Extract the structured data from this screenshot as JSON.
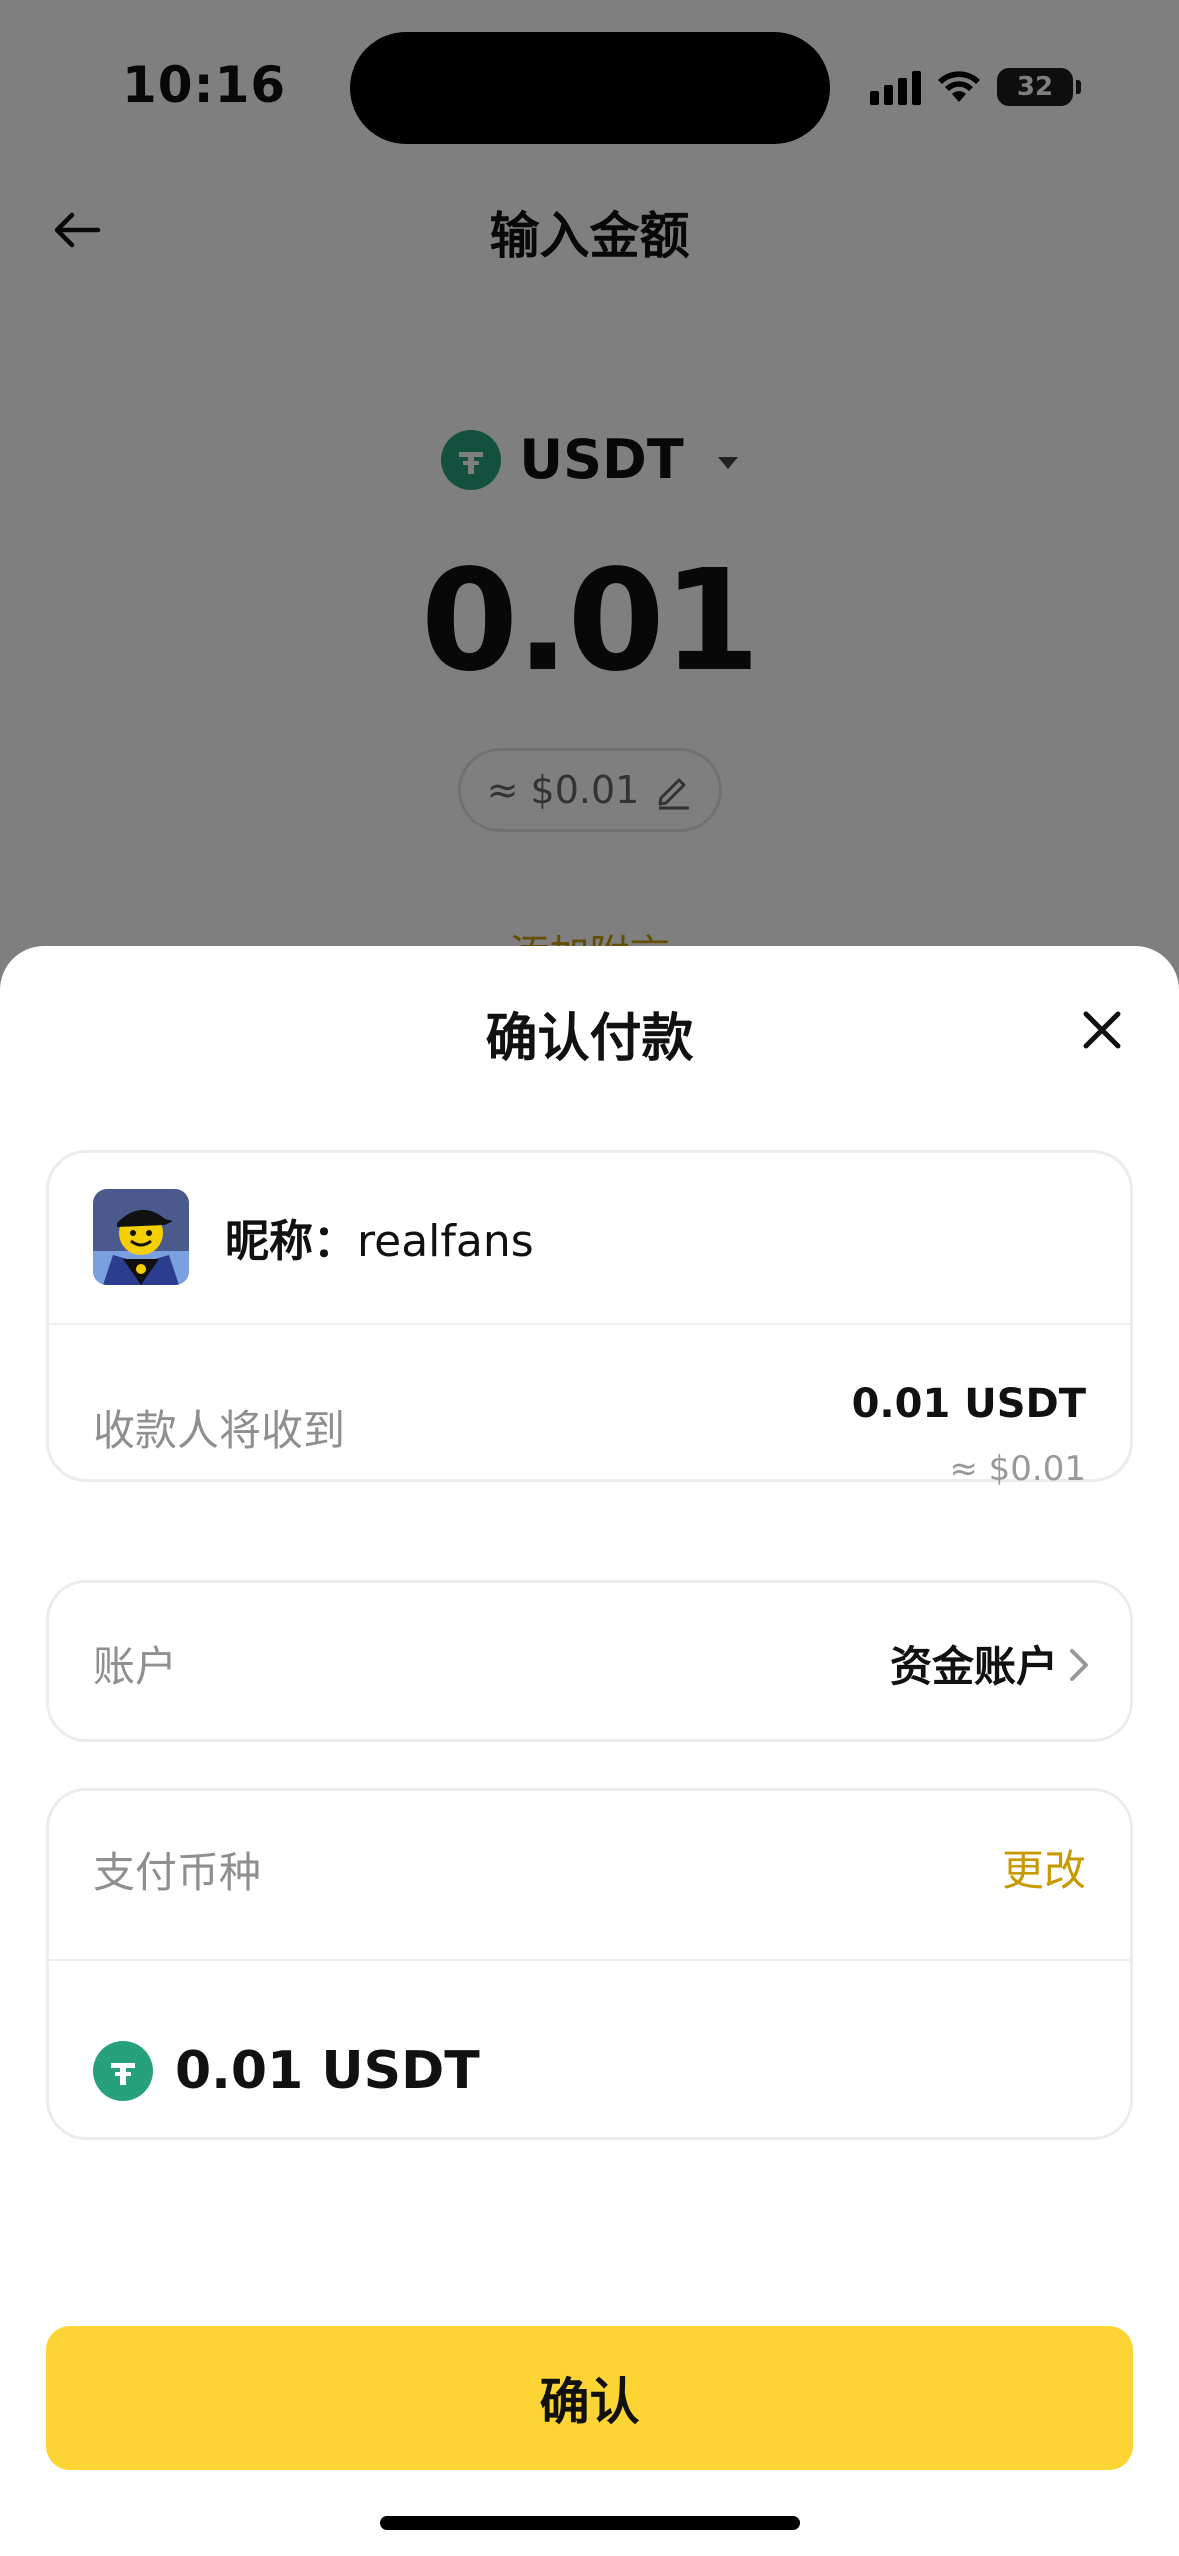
{
  "status_bar": {
    "time": "10:16",
    "battery": "32"
  },
  "background": {
    "title": "输入金额",
    "coin": "USDT",
    "amount": "0.01",
    "fiat_estimate": "≈ $0.01",
    "add_note": "添加附言"
  },
  "sheet": {
    "title": "确认付款",
    "recipient": {
      "nickname_label": "昵称：",
      "nickname": "realfans"
    },
    "receive": {
      "label": "收款人将收到",
      "amount": "0.01 USDT",
      "fiat": "≈ $0.01"
    },
    "account": {
      "label": "账户",
      "value": "资金账户"
    },
    "pay_currency": {
      "label": "支付币种",
      "change": "更改",
      "amount": "0.01 USDT"
    },
    "confirm_label": "确认"
  },
  "colors": {
    "accent_yellow": "#fcd535",
    "accent_text": "#c99a00",
    "tether_green": "#26a17b"
  }
}
